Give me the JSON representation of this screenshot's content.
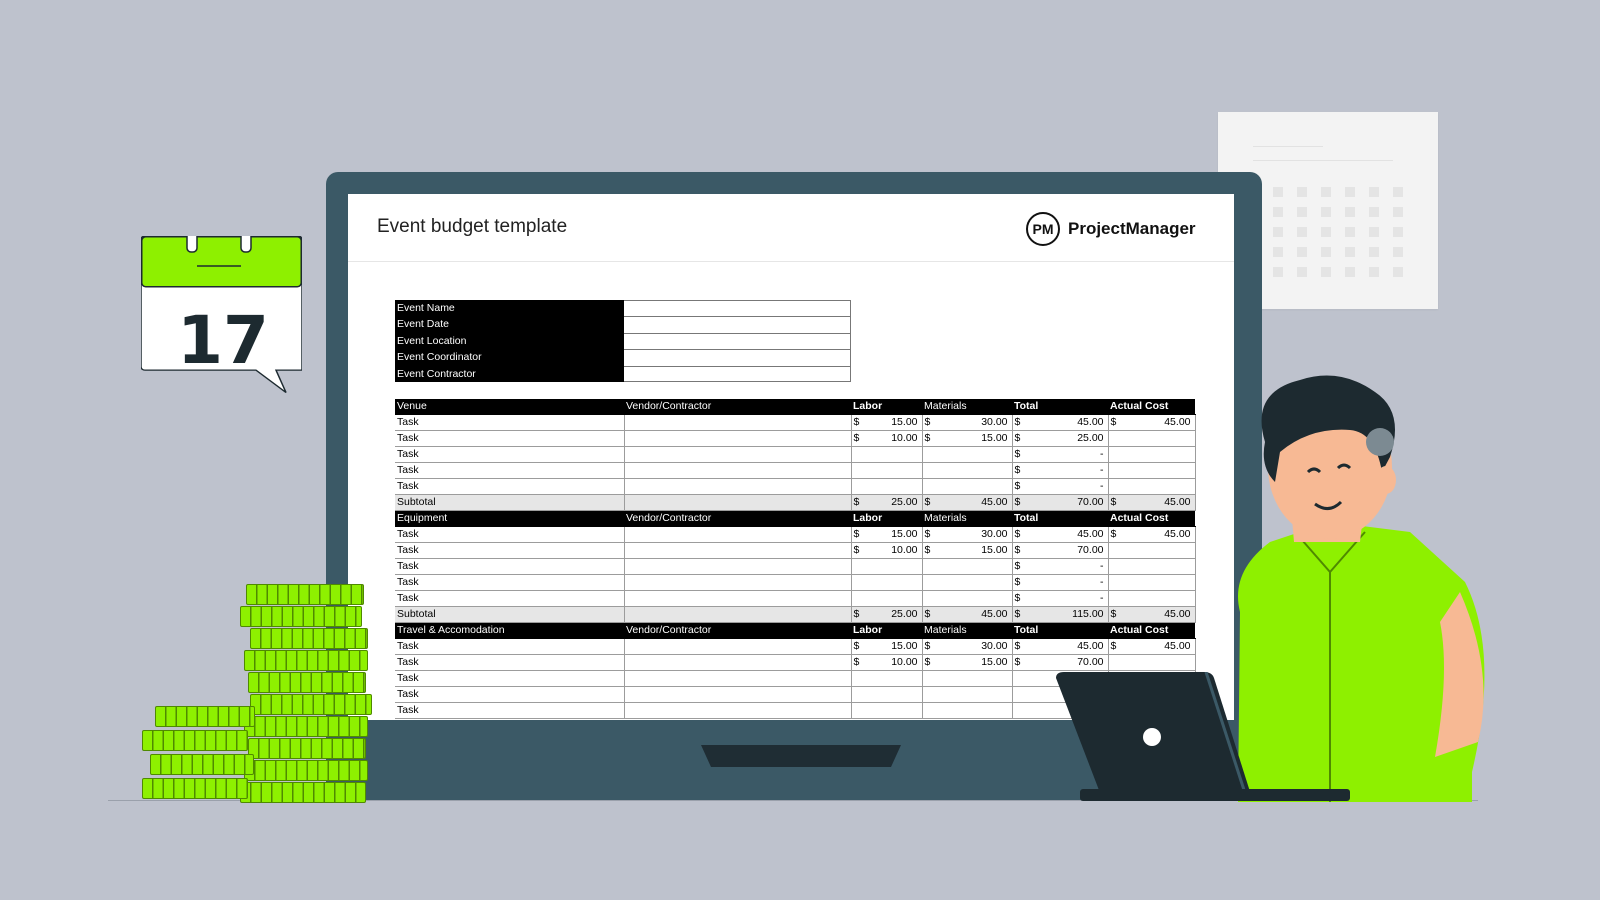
{
  "screen": {
    "title": "Event budget template",
    "logo_mark": "PM",
    "logo_name": "ProjectManager"
  },
  "calendar_icon": {
    "day": "17"
  },
  "info_fields": [
    "Event Name",
    "Event Date",
    "Event Location",
    "Event Coordinator",
    "Event Contractor"
  ],
  "columns": {
    "vendor": "Vendor/Contractor",
    "labor": "Labor",
    "materials": "Materials",
    "total": "Total",
    "actual": "Actual Cost"
  },
  "currency": "$",
  "sections": [
    {
      "name": "Venue",
      "rows": [
        {
          "task": "Task",
          "labor": "15.00",
          "materials": "30.00",
          "total": "45.00",
          "actual": "45.00"
        },
        {
          "task": "Task",
          "labor": "10.00",
          "materials": "15.00",
          "total": "25.00",
          "actual": ""
        },
        {
          "task": "Task",
          "labor": "",
          "materials": "",
          "total": "-",
          "actual": ""
        },
        {
          "task": "Task",
          "labor": "",
          "materials": "",
          "total": "-",
          "actual": ""
        },
        {
          "task": "Task",
          "labor": "",
          "materials": "",
          "total": "-",
          "actual": ""
        }
      ],
      "subtotal": {
        "label": "Subtotal",
        "labor": "25.00",
        "materials": "45.00",
        "total": "70.00",
        "actual": "45.00"
      }
    },
    {
      "name": "Equipment",
      "rows": [
        {
          "task": "Task",
          "labor": "15.00",
          "materials": "30.00",
          "total": "45.00",
          "actual": "45.00"
        },
        {
          "task": "Task",
          "labor": "10.00",
          "materials": "15.00",
          "total": "70.00",
          "actual": ""
        },
        {
          "task": "Task",
          "labor": "",
          "materials": "",
          "total": "-",
          "actual": ""
        },
        {
          "task": "Task",
          "labor": "",
          "materials": "",
          "total": "-",
          "actual": ""
        },
        {
          "task": "Task",
          "labor": "",
          "materials": "",
          "total": "-",
          "actual": ""
        }
      ],
      "subtotal": {
        "label": "Subtotal",
        "labor": "25.00",
        "materials": "45.00",
        "total": "115.00",
        "actual": "45.00"
      }
    },
    {
      "name": "Travel & Accomodation",
      "rows": [
        {
          "task": "Task",
          "labor": "15.00",
          "materials": "30.00",
          "total": "45.00",
          "actual": "45.00"
        },
        {
          "task": "Task",
          "labor": "10.00",
          "materials": "15.00",
          "total": "70.00",
          "actual": ""
        },
        {
          "task": "Task",
          "labor": "",
          "materials": "",
          "total": "",
          "actual": ""
        },
        {
          "task": "Task",
          "labor": "",
          "materials": "",
          "total": "",
          "actual": ""
        },
        {
          "task": "Task",
          "labor": "",
          "materials": "",
          "total": "",
          "actual": ""
        }
      ]
    }
  ],
  "colors": {
    "background": "#bec2cd",
    "monitor": "#3b5966",
    "accent_green": "#8ef000",
    "dark": "#1d2a30"
  }
}
